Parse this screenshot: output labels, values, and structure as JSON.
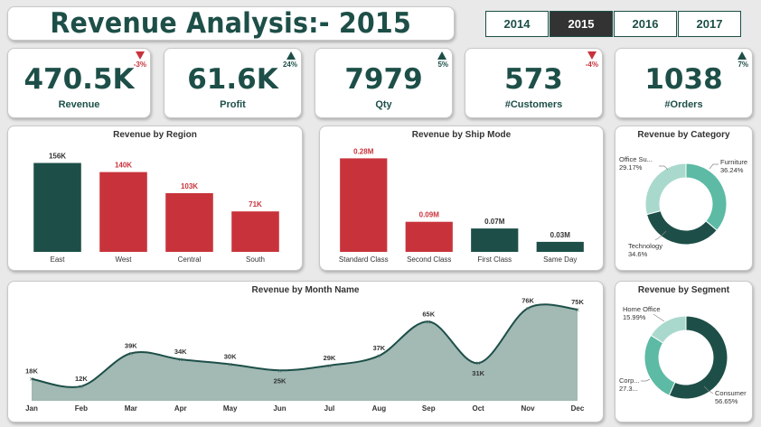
{
  "header": {
    "title": "Revenue Analysis:- 2015"
  },
  "years": [
    {
      "label": "2014",
      "active": false
    },
    {
      "label": "2015",
      "active": true
    },
    {
      "label": "2016",
      "active": false
    },
    {
      "label": "2017",
      "active": false
    }
  ],
  "kpis": [
    {
      "value": "470.5K",
      "label": "Revenue",
      "change": "-3%",
      "direction": "down"
    },
    {
      "value": "61.6K",
      "label": "Profit",
      "change": "24%",
      "direction": "up"
    },
    {
      "value": "7979",
      "label": "Qty",
      "change": "5%",
      "direction": "up"
    },
    {
      "value": "573",
      "label": "#Customers",
      "change": "-4%",
      "direction": "down"
    },
    {
      "value": "1038",
      "label": "#Orders",
      "change": "7%",
      "direction": "up"
    }
  ],
  "colors": {
    "dark": "#1d4f48",
    "red": "#c8333b",
    "teal": "#5dbaa4",
    "light": "#a9d9cd",
    "area": "#a2b9b4"
  },
  "chart_data": [
    {
      "type": "bar",
      "title": "Revenue by Region",
      "categories": [
        "East",
        "West",
        "Central",
        "South"
      ],
      "values": [
        156,
        140,
        103,
        71
      ],
      "labels": [
        "156K",
        "140K",
        "103K",
        "71K"
      ],
      "colors": [
        "#1d4f48",
        "#c8333b",
        "#c8333b",
        "#c8333b"
      ],
      "ylim": [
        0,
        160
      ]
    },
    {
      "type": "bar",
      "title": "Revenue by Ship Mode",
      "categories": [
        "Standard Class",
        "Second Class",
        "First Class",
        "Same Day"
      ],
      "values": [
        0.28,
        0.09,
        0.07,
        0.03
      ],
      "labels": [
        "0.28M",
        "0.09M",
        "0.07M",
        "0.03M"
      ],
      "colors": [
        "#c8333b",
        "#c8333b",
        "#1d4f48",
        "#1d4f48"
      ],
      "ylim": [
        0,
        0.3
      ]
    },
    {
      "type": "pie",
      "title": "Revenue by Category",
      "categories": [
        "Furniture",
        "Technology",
        "Office Su..."
      ],
      "values": [
        36.24,
        34.6,
        29.17
      ],
      "labels": [
        "36.24%",
        "34.6%",
        "29.17%"
      ],
      "colors": [
        "#5dbaa4",
        "#1d4f48",
        "#a9d9cd"
      ]
    },
    {
      "type": "area",
      "title": "Revenue by Month Name",
      "categories": [
        "Jan",
        "Feb",
        "Mar",
        "Apr",
        "May",
        "Jun",
        "Jul",
        "Aug",
        "Sep",
        "Oct",
        "Nov",
        "Dec"
      ],
      "values": [
        18,
        12,
        39,
        34,
        30,
        25,
        29,
        37,
        65,
        31,
        76,
        75
      ],
      "labels": [
        "18K",
        "12K",
        "39K",
        "34K",
        "30K",
        "25K",
        "29K",
        "37K",
        "65K",
        "31K",
        "76K",
        "75K"
      ],
      "ylim": [
        0,
        80
      ]
    },
    {
      "type": "pie",
      "title": "Revenue by Segment",
      "categories": [
        "Consumer",
        "Corp...",
        "Home Office"
      ],
      "values": [
        56.65,
        27.36,
        15.99
      ],
      "labels": [
        "56.65%",
        "27.3...",
        "15.99%"
      ],
      "colors": [
        "#1d4f48",
        "#5dbaa4",
        "#a9d9cd"
      ]
    }
  ]
}
